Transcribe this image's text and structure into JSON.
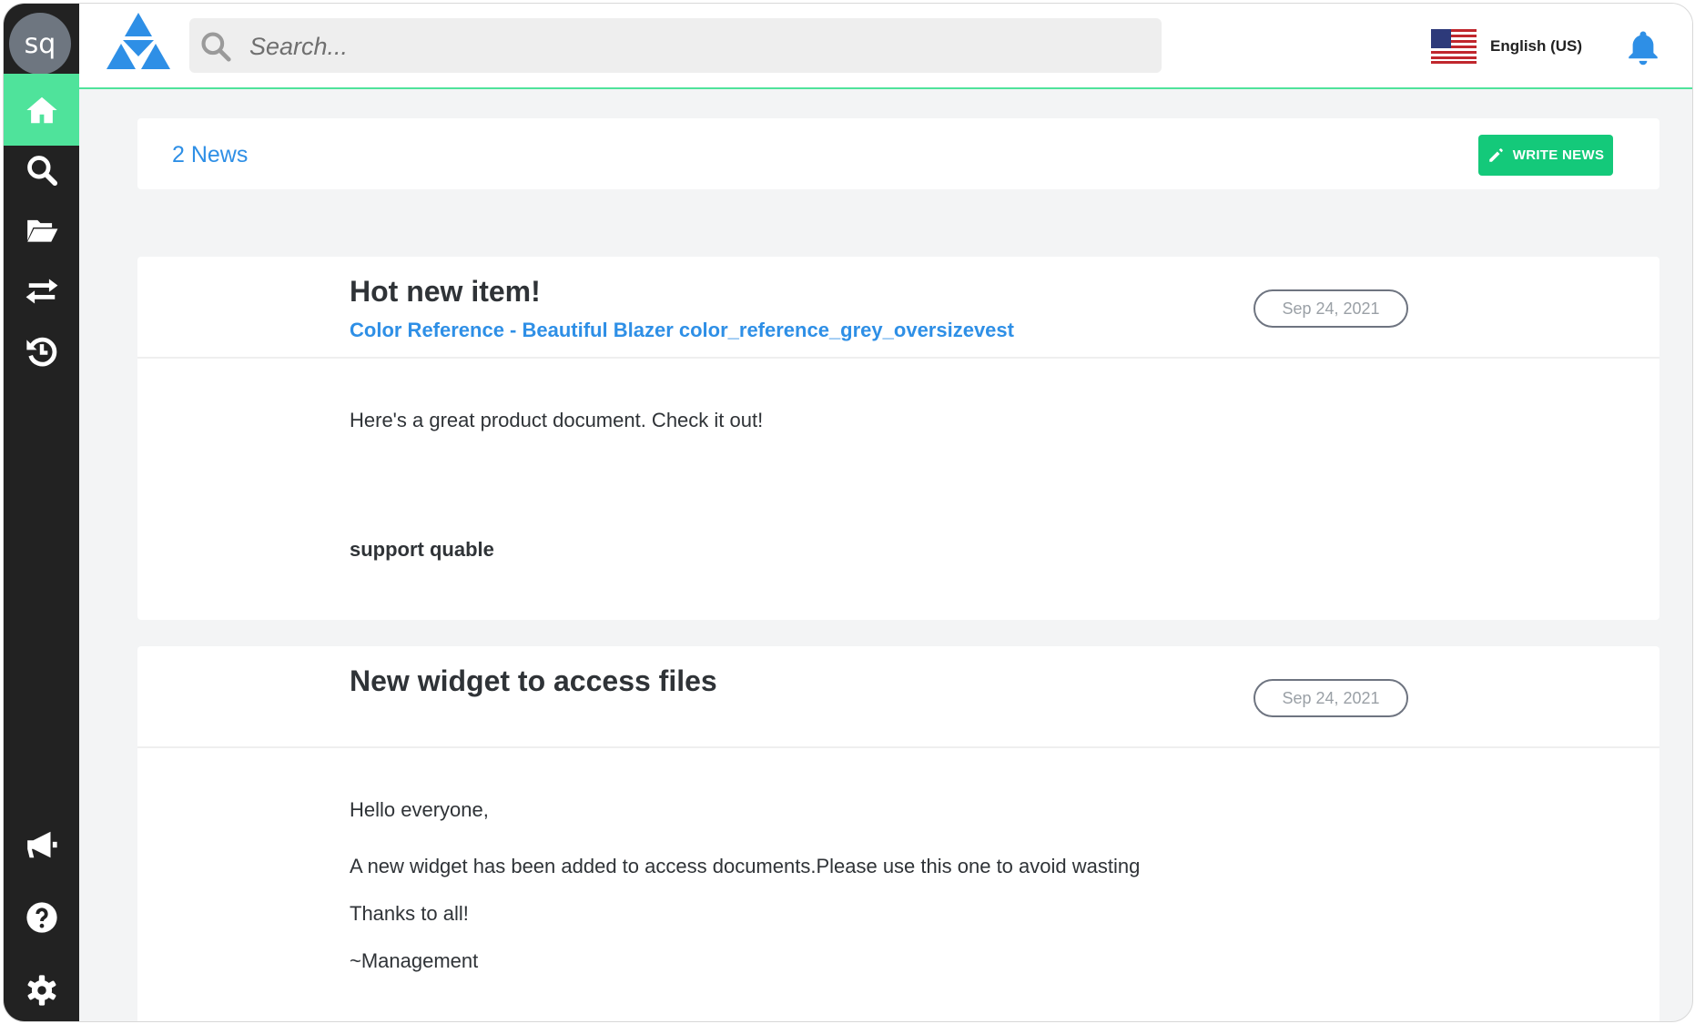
{
  "sidebar": {
    "avatar_initials": "sq",
    "items": [
      {
        "name": "home",
        "icon": "home-icon"
      },
      {
        "name": "search",
        "icon": "search-icon"
      },
      {
        "name": "documents",
        "icon": "folder-open-icon"
      },
      {
        "name": "transfers",
        "icon": "exchange-icon"
      },
      {
        "name": "history",
        "icon": "history-icon"
      },
      {
        "name": "news",
        "icon": "megaphone-icon"
      },
      {
        "name": "help",
        "icon": "question-circle-icon"
      },
      {
        "name": "settings",
        "icon": "gear-icon"
      }
    ],
    "active_color": "#4fe39b",
    "bg_color": "#222222"
  },
  "header": {
    "search_placeholder": "Search...",
    "language_label": "English (US)",
    "accent_color": "#2e8fe6"
  },
  "news": {
    "count_label": "2 News",
    "write_button_label": "WRITE NEWS",
    "items": [
      {
        "title": "Hot new item!",
        "link": "Color Reference - Beautiful Blazer color_reference_grey_oversizevest",
        "date": "Sep 24, 2021",
        "body": [
          "Here's a great product document. Check it out!",
          "support quable"
        ]
      },
      {
        "title": "New widget to access files",
        "date": "Sep 24, 2021",
        "body": [
          "Hello everyone,",
          "A new widget has been added to access documents.Please use this one to avoid wasting",
          "Thanks to all!",
          "~Management"
        ]
      }
    ]
  }
}
